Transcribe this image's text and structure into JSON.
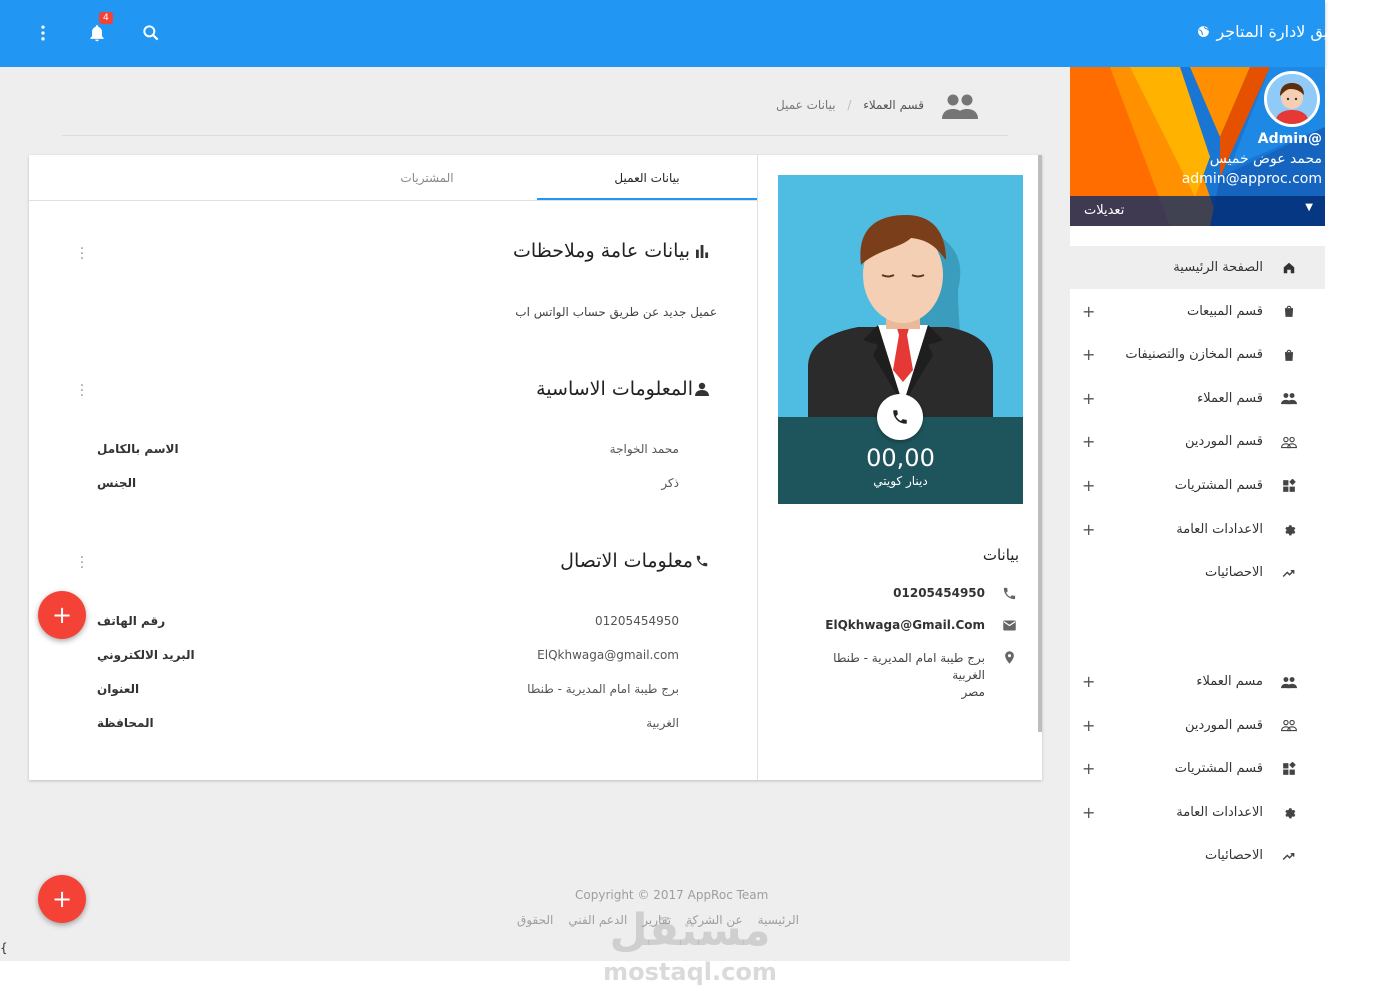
{
  "app": {
    "title": "تطبيق لادارة المتاجر",
    "notification_count": "4"
  },
  "breadcrumb": {
    "section": "قسم العملاء",
    "separator": "/",
    "current": "بيانات عميل"
  },
  "profile": {
    "handle": "@Admin",
    "name": "محمد عوض خميس",
    "email": "admin@approc.com",
    "settings_label": "تعديلات"
  },
  "nav": {
    "primary": [
      {
        "label": "الصفحة الرئيسية",
        "icon": "home-icon",
        "active": true,
        "plus": false
      },
      {
        "label": "قسم المبيعات",
        "icon": "shopping-bag-icon",
        "plus": true
      },
      {
        "label": "قسم المخازن والتصنيفات",
        "icon": "shopping-bag-icon",
        "plus": true
      },
      {
        "label": "قسم العملاء",
        "icon": "people-icon",
        "plus": true
      },
      {
        "label": "قسم الموردين",
        "icon": "people-outline-icon",
        "plus": true
      },
      {
        "label": "قسم المشتريات",
        "icon": "widgets-icon",
        "plus": true
      },
      {
        "label": "الاعدادات العامة",
        "icon": "gear-icon",
        "plus": true
      },
      {
        "label": "الاحصائيات",
        "icon": "trending-up-icon",
        "plus": false
      }
    ],
    "secondary": [
      {
        "label": "مسم العملاء",
        "icon": "people-icon",
        "plus": true
      },
      {
        "label": "قسم الموردين",
        "icon": "people-outline-icon",
        "plus": true
      },
      {
        "label": "قسم المشتريات",
        "icon": "widgets-icon",
        "plus": true
      },
      {
        "label": "الاعدادات العامة",
        "icon": "gear-icon",
        "plus": true
      },
      {
        "label": "الاحصائيات",
        "icon": "trending-up-icon",
        "plus": false
      }
    ]
  },
  "tabs": {
    "customer_data": "بيانات العميل",
    "purchases": "المشتريات"
  },
  "general": {
    "title": "بيانات عامة وملاحظات",
    "note": "عميل جديد عن طريق حساب الواتس اب"
  },
  "basic": {
    "title": "المعلومات الاساسية",
    "rows": [
      {
        "label": "الاسم بالكامل",
        "value": "محمد الخواجة"
      },
      {
        "label": "الجنس",
        "value": "ذكر"
      }
    ]
  },
  "contact": {
    "title": "معلومات الاتصال",
    "rows": [
      {
        "label": "رقم الهاتف",
        "value": "01205454950"
      },
      {
        "label": "البريد الالكتروني",
        "value": "ElQkhwaga@gmail.com"
      },
      {
        "label": "العنوان",
        "value": "برج طيبة امام المديرية - طنطا"
      },
      {
        "label": "المحافظة",
        "value": "الغربية"
      }
    ]
  },
  "customer_card": {
    "balance": "00,00",
    "currency": "دينار كويتي",
    "info_title": "بيانات",
    "phone": "01205454950",
    "email": "ElQkhwaga@Gmail.Com",
    "address_line1": "برج طيبة امام المديرية - طنطا",
    "address_line2": "الغربية",
    "address_line3": "مصر"
  },
  "footer": {
    "copyright": "Copyright © 2017 AppRoc Team",
    "links": [
      "الرئيسية",
      "عن الشركة",
      "تقارير",
      "الدعم الفني",
      "الحقوق"
    ]
  },
  "watermark": {
    "arabic": "مستقل",
    "latin": "mostaql.com"
  },
  "stray_char": "{",
  "colors": {
    "primary": "#2196f3",
    "fab": "#f44336",
    "card_photo_bg": "#4fbde2",
    "card_balance_bg": "#1e555c"
  }
}
